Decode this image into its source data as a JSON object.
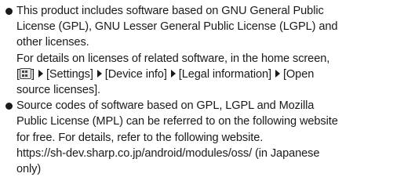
{
  "items": [
    {
      "lines": [
        "This product includes software based on GNU General Public",
        "License (GPL), GNU Lesser General Public License (LGPL) and",
        "other licenses.",
        "For details on licenses of related software, in the home screen,"
      ],
      "path": {
        "open": "[",
        "close": "]",
        "settings": "[Settings]",
        "device_info": "[Device info]",
        "legal_information": "[Legal information]",
        "open_part": "[Open",
        "last_line": "source licenses]."
      }
    },
    {
      "lines": [
        "Source codes of software based on GPL, LGPL and Mozilla",
        "Public License (MPL) can be referred to on the following website",
        "for free. For details, refer to the following website.",
        "https://sh-dev.sharp.co.jp/android/modules/oss/ (in Japanese",
        "only)"
      ]
    }
  ],
  "icons": [
    "app-screen-icon",
    "arrow-right-icon"
  ]
}
